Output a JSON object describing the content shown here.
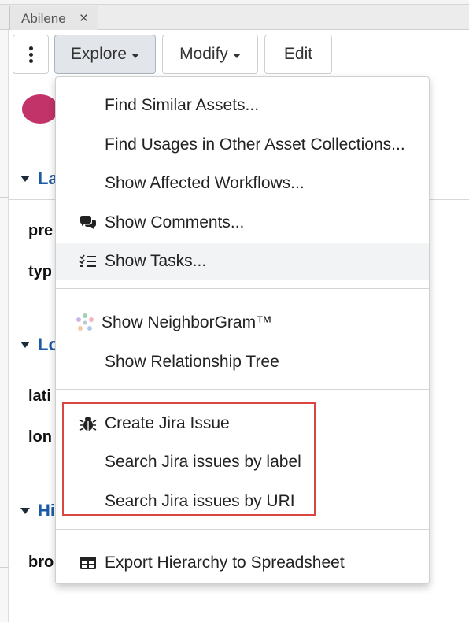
{
  "tab": {
    "title": "Abilene",
    "close_glyph": "×"
  },
  "toolbar": {
    "more_icon": "kebab-icon",
    "explore_label": "Explore",
    "modify_label": "Modify",
    "edit_label": "Edit"
  },
  "page": {
    "sections": [
      {
        "heading": "La",
        "fields": [
          "pre",
          "typ"
        ]
      },
      {
        "heading": "Lo",
        "fields": [
          "lati",
          "lon"
        ]
      },
      {
        "heading": "Hi",
        "fields": [
          "bro"
        ]
      }
    ]
  },
  "menu": {
    "group1": [
      {
        "label": "Find Similar Assets...",
        "icon": ""
      },
      {
        "label": "Find Usages in Other Asset Collections...",
        "icon": ""
      },
      {
        "label": "Show Affected Workflows...",
        "icon": ""
      },
      {
        "label": "Show Comments...",
        "icon": "comments-icon"
      },
      {
        "label": "Show Tasks...",
        "icon": "tasks-icon"
      }
    ],
    "group2": [
      {
        "label": "Show NeighborGram™",
        "icon": "neighborgram-icon"
      },
      {
        "label": "Show Relationship Tree",
        "icon": ""
      }
    ],
    "group3": [
      {
        "label": "Create Jira Issue",
        "icon": "bug-icon"
      },
      {
        "label": "Search Jira issues by label",
        "icon": ""
      },
      {
        "label": "Search Jira issues by URI",
        "icon": ""
      }
    ],
    "group4": [
      {
        "label": "Export Hierarchy to Spreadsheet",
        "icon": "table-icon"
      }
    ]
  },
  "colors": {
    "annotation_box": "#d9463f",
    "section_heading": "#1d5aa6",
    "avatar": "#c2336a"
  }
}
